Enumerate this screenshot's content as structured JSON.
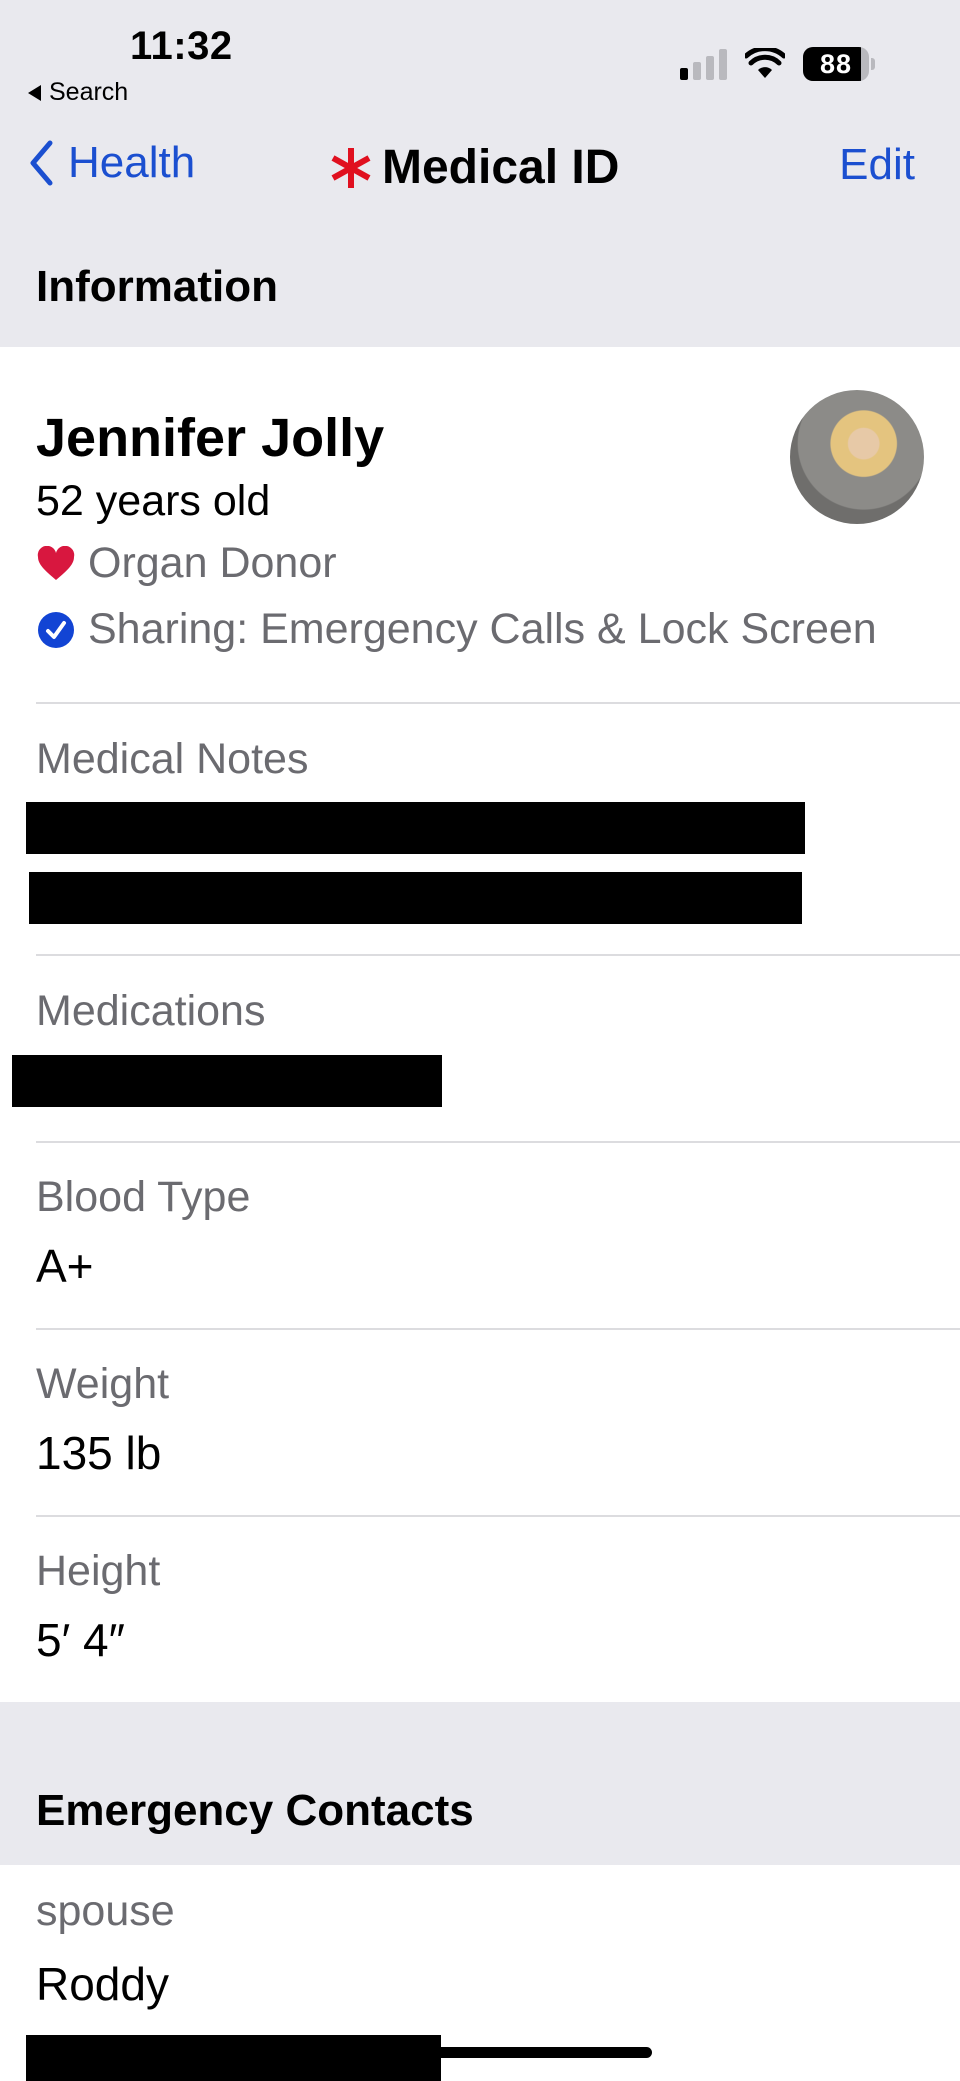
{
  "status_bar": {
    "time": "11:32",
    "back_app_label": "Search",
    "signal_bars_active": 1,
    "signal_bars_total": 4,
    "battery_percent": 88,
    "battery_label": "88"
  },
  "nav": {
    "back_label": "Health",
    "title": "Medical ID",
    "edit_label": "Edit",
    "title_icon": "asterisk-icon",
    "accent_color": "#1b4fd0",
    "title_icon_color": "#e0101f"
  },
  "information": {
    "section_title": "Information",
    "name": "Jennifer Jolly",
    "age": "52 years old",
    "organ_donor_label": "Organ Donor",
    "sharing_label": "Sharing: Emergency Calls & Lock Screen",
    "avatar": "profile-photo",
    "fields": [
      {
        "label": "Medical Notes",
        "value": "[redacted]"
      },
      {
        "label": "Medications",
        "value": "[redacted]"
      },
      {
        "label": "Blood Type",
        "value": "A+"
      },
      {
        "label": "Weight",
        "value": "135 lb"
      },
      {
        "label": "Height",
        "value": "5′ 4″"
      }
    ]
  },
  "emergency_contacts": {
    "section_title": "Emergency Contacts",
    "contacts": [
      {
        "relationship": "spouse",
        "name": "Roddy",
        "phone": "[redacted]"
      }
    ]
  }
}
